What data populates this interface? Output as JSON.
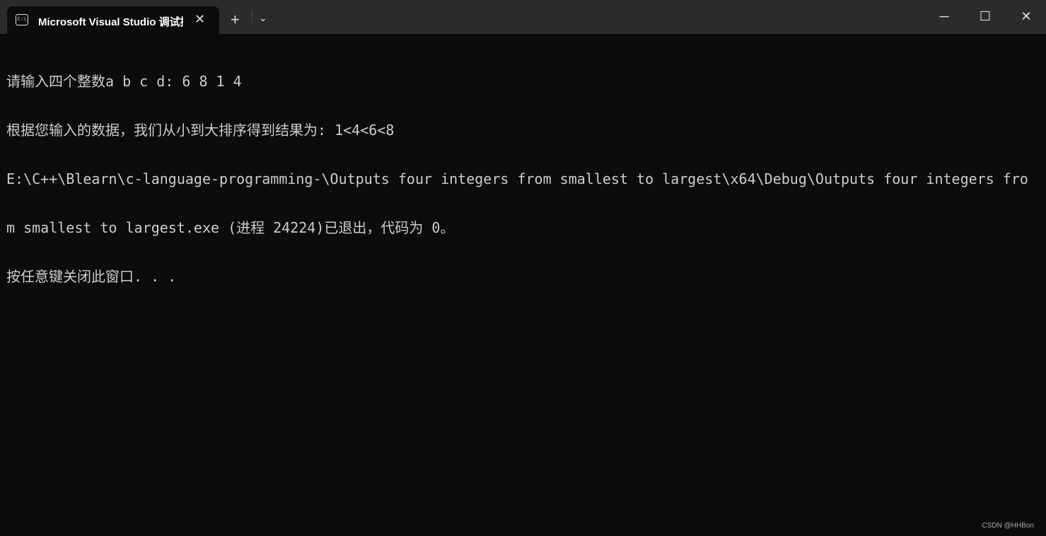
{
  "tab": {
    "title": "Microsoft Visual Studio 调试控制台",
    "icon": "terminal-icon",
    "icon_text": "C:\\"
  },
  "window_controls": {
    "minimize": "─",
    "maximize": "☐",
    "close": "✕"
  },
  "tab_controls": {
    "close": "✕",
    "new_tab": "+",
    "dropdown": "⌄"
  },
  "terminal": {
    "lines": [
      "请输入四个整数a b c d: 6 8 1 4",
      "根据您输入的数据，我们从小到大排序得到结果为: 1<4<6<8",
      "E:\\C++\\Blearn\\c-language-programming-\\Outputs four integers from smallest to largest\\x64\\Debug\\Outputs four integers fro",
      "m smallest to largest.exe (进程 24224)已退出，代码为 0。",
      "按任意键关闭此窗口. . ."
    ]
  },
  "watermark": "CSDN @HHBon"
}
